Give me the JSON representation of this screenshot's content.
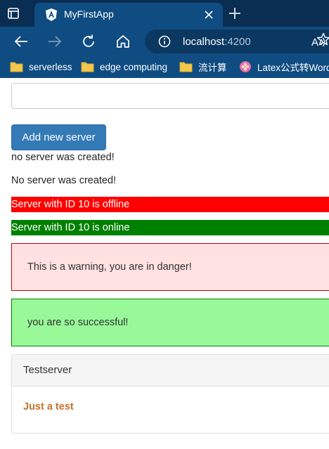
{
  "browser": {
    "tab": {
      "title": "MyFirstApp"
    },
    "url": {
      "host": "localhost",
      "port": ":4200"
    },
    "bookmarks": [
      {
        "label": "serverless",
        "icon": "folder-icon"
      },
      {
        "label": "edge computing",
        "icon": "folder-icon"
      },
      {
        "label": "流计算",
        "icon": "folder-icon"
      },
      {
        "label": "Latex公式转Word",
        "icon": "flower-icon"
      }
    ]
  },
  "page": {
    "server_input": {
      "value": ""
    },
    "add_button_label": "Add new server",
    "creation_status_1": "no server was created!",
    "creation_status_2": "No server was created!",
    "server_offline": "Server with ID 10 is offline",
    "server_online": "Server with ID 10 is online",
    "warning_alert": "This is a warning, you are in danger!",
    "success_alert": "you are so successful!",
    "panel": {
      "heading": "Testserver",
      "body": "Just a test"
    }
  },
  "colors": {
    "chrome_dark": "#0a2d52",
    "chrome": "#0f4c81",
    "primary_button": "#337ab7",
    "offline": "#ff0000",
    "online": "#008000",
    "warning_bg": "#ffe1e1",
    "success_bg": "#99f999",
    "panel_body_text": "#c4732e"
  }
}
